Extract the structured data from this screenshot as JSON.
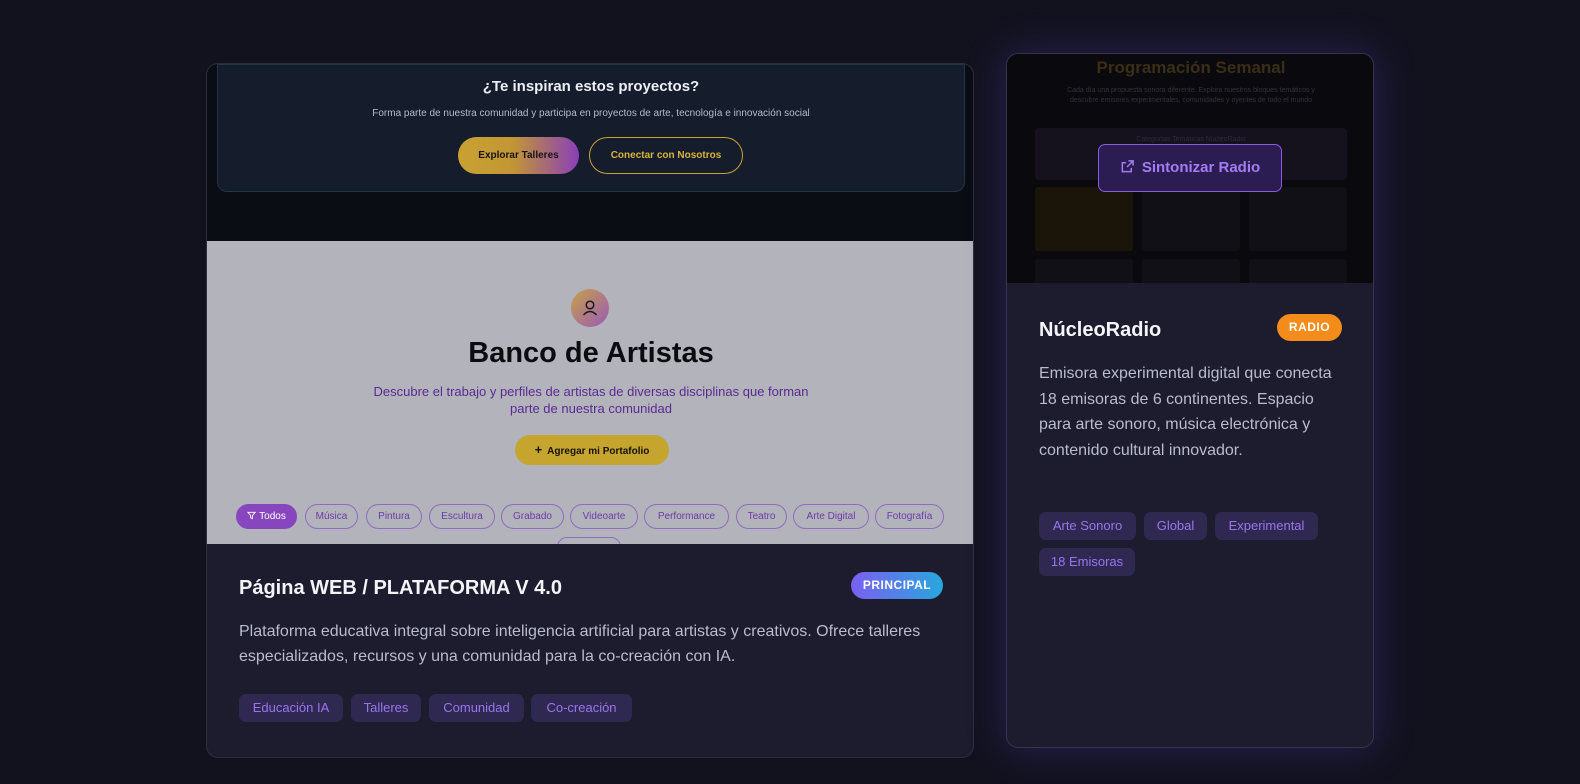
{
  "projects": [
    {
      "preview": {
        "cta": {
          "title": "¿Te inspiran estos proyectos?",
          "subtitle": "Forma parte de nuestra comunidad y participa en proyectos de arte, tecnología e innovación social",
          "primary_button": "Explorar Talleres",
          "secondary_button": "Conectar con Nosotros"
        },
        "artists": {
          "avatar_icon": "user-icon",
          "title": "Banco de Artistas",
          "description": "Descubre el trabajo y perfiles de artistas de diversas disciplinas que forman parte de nuestra comunidad",
          "add_button": "Agregar mi Portafolio",
          "filters": [
            "Todos",
            "Música",
            "Pintura",
            "Escultura",
            "Grabado",
            "Videoarte",
            "Performance",
            "Teatro",
            "Arte Digital",
            "Fotografía"
          ],
          "active_filter": "Todos"
        }
      },
      "title": "Página WEB / PLATAFORMA V 4.0",
      "badge": "PRINCIPAL",
      "description": "Plataforma educativa integral sobre inteligencia artificial para artistas y creativos. Ofrece talleres especializados, recursos y una comunidad para la co-creación con IA.",
      "tags": [
        "Educación IA",
        "Talleres",
        "Comunidad",
        "Co-creación"
      ]
    },
    {
      "preview": {
        "title": "Programación Semanal",
        "subtitle": "Cada día una propuesta sonora diferente. Explora nuestros bloques temáticos y descubre emisores experimentales, comunidades y oyentes de todo el mundo",
        "band_text": "Categorías Temáticas NúcleoRadio",
        "button": "Sintonizar Radio",
        "button_icon": "external-link-icon"
      },
      "title": "NúcleoRadio",
      "badge": "RADIO",
      "description": "Emisora experimental digital que conecta 18 emisoras de 6 continentes. Espacio para arte sonoro, música electrónica y contenido cultural innovador.",
      "tags": [
        "Arte Sonoro",
        "Global",
        "Experimental",
        "18 Emisoras"
      ]
    }
  ],
  "colors": {
    "background": "#12121f",
    "card": "#1c1c2e",
    "tag_bg": "#2f2951",
    "tag_text": "#9b74ee",
    "badge_principal_from": "#7b5ff0",
    "badge_principal_to": "#28a7de",
    "badge_radio": "#f38c1a",
    "gold": "#c9a231",
    "purple": "#8746bd"
  }
}
